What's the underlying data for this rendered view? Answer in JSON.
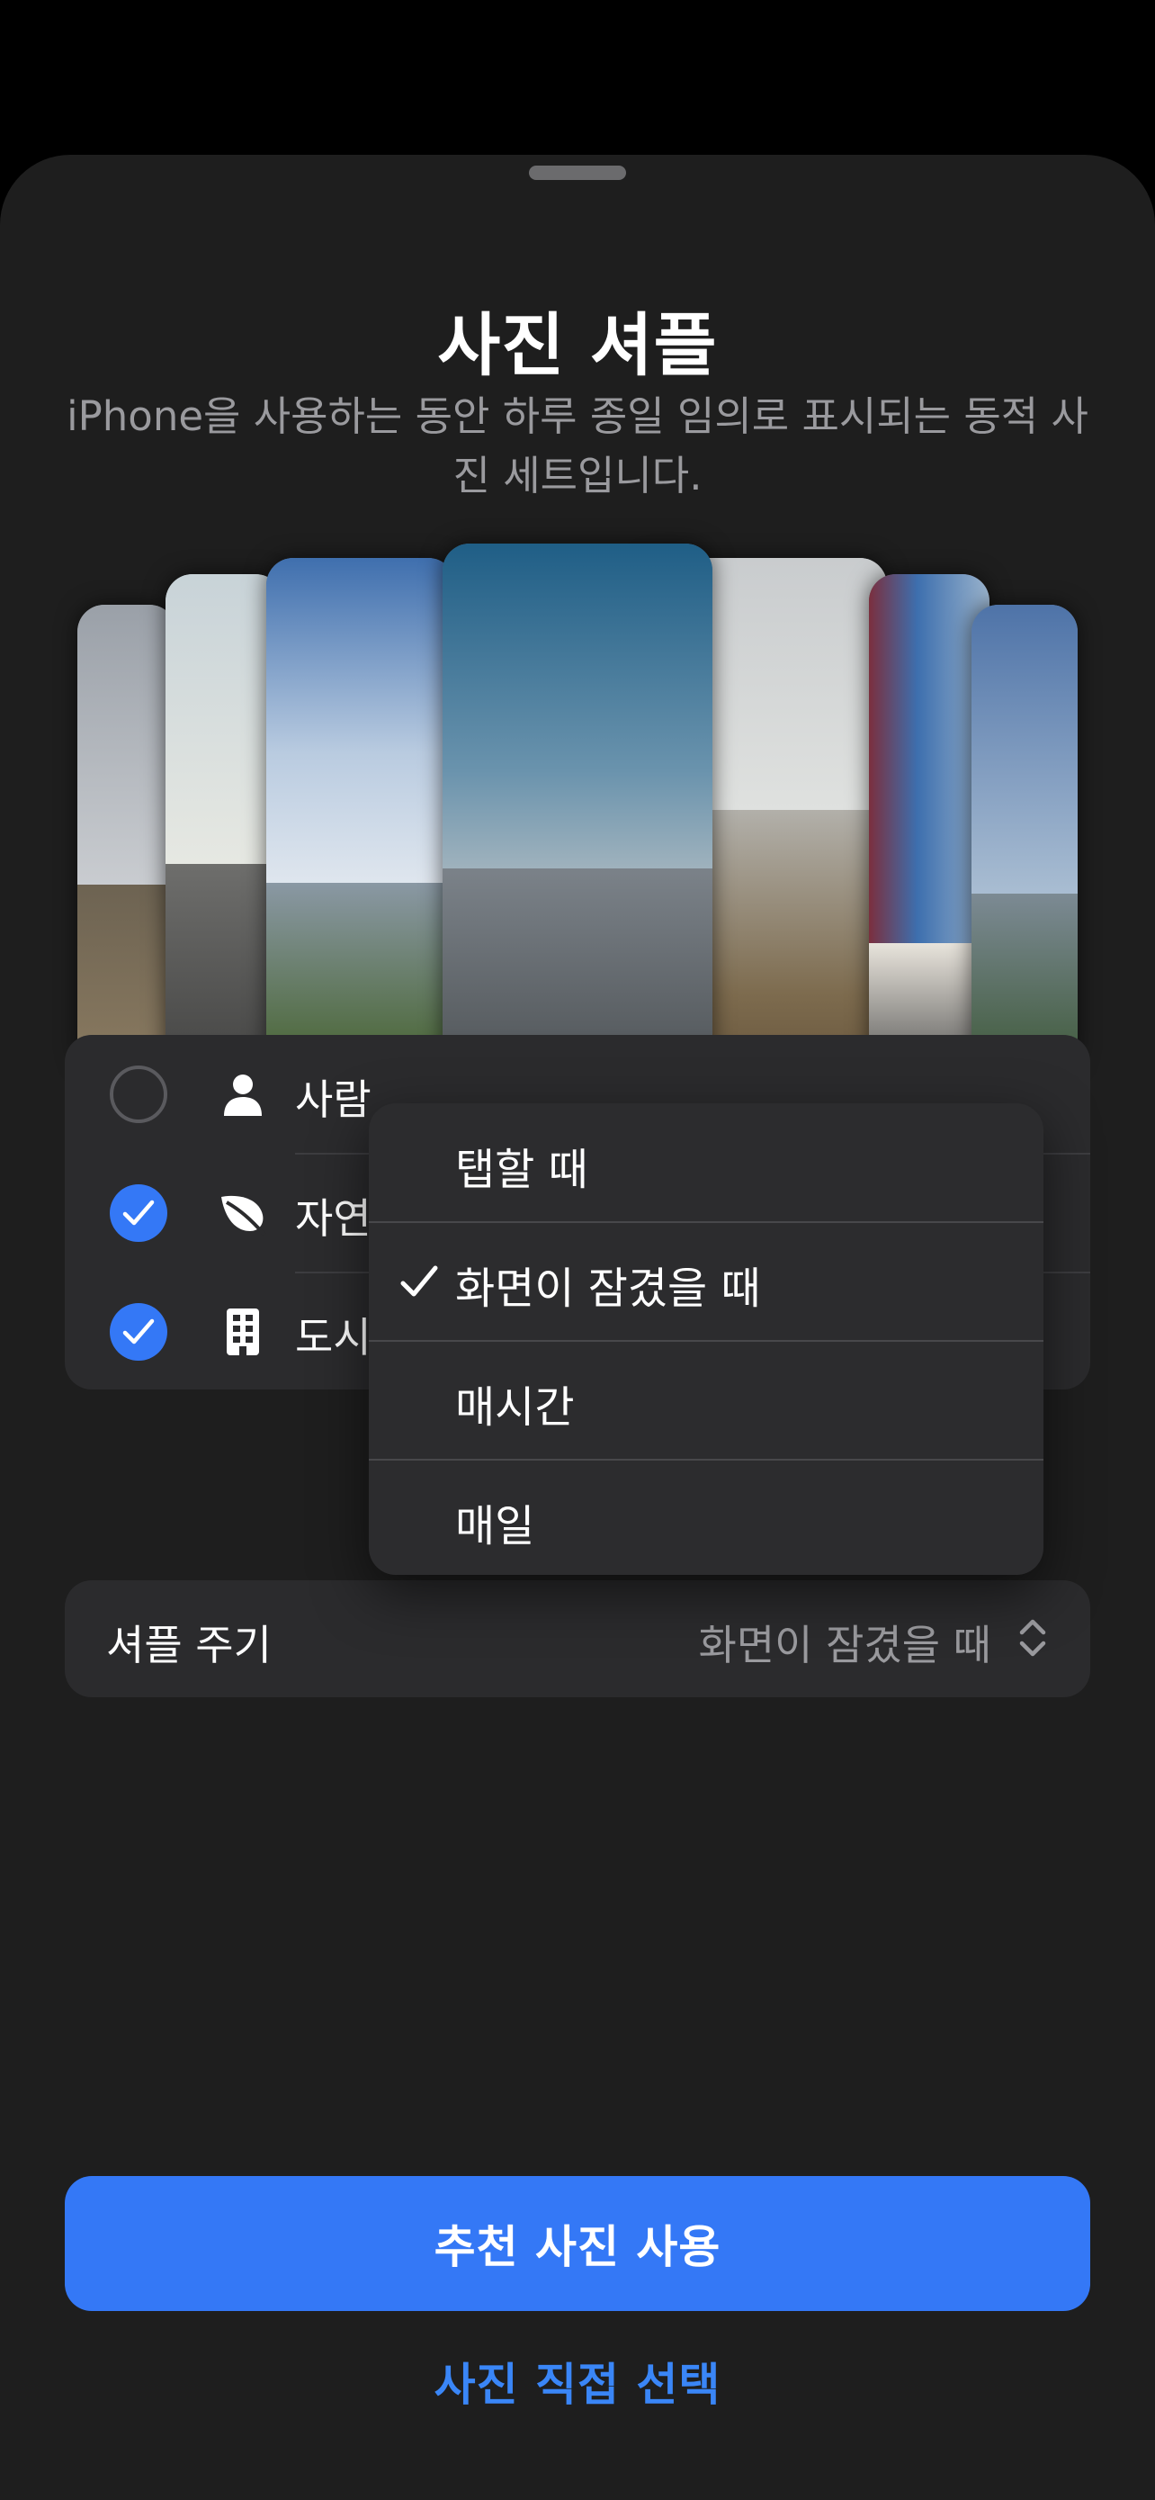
{
  "header": {
    "title": "사진 셔플",
    "subtitle": "iPhone을 사용하는 동안 하루 종일 임의로 표시되는 동적 사진 세트입니다."
  },
  "categories": [
    {
      "label": "사람",
      "icon": "person-icon",
      "checked": false
    },
    {
      "label": "자연",
      "icon": "leaf-icon",
      "checked": true
    },
    {
      "label": "도시",
      "icon": "building-icon",
      "checked": true
    }
  ],
  "frequency": {
    "label": "셔플 주기",
    "value": "화면이 잠겼을 때"
  },
  "menu": {
    "items": [
      {
        "label": "탭할 때",
        "selected": false
      },
      {
        "label": "화면이 잠겼을 때",
        "selected": true
      },
      {
        "label": "매시간",
        "selected": false
      },
      {
        "label": "매일",
        "selected": false
      }
    ]
  },
  "buttons": {
    "primary": "추천 사진 사용",
    "secondary": "사진 직접 선택"
  },
  "colors": {
    "accent": "#3478f6",
    "background": "#1e1e1e",
    "card": "#2b2b2d"
  }
}
